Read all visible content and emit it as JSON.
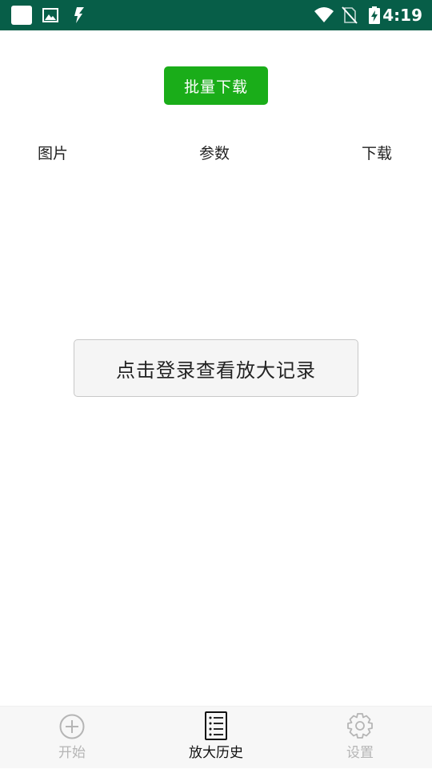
{
  "status_bar": {
    "time": "4:19",
    "icons": [
      "notification-square-icon",
      "image-icon",
      "bolt-app-icon",
      "wifi-icon",
      "no-sim-icon",
      "battery-charging-icon"
    ],
    "background_color": "#075e48"
  },
  "toolbar": {
    "batch_download_label": "批量下载",
    "accent_color": "#1aad19"
  },
  "table": {
    "headers": [
      "图片",
      "参数",
      "下载"
    ]
  },
  "main": {
    "login_prompt": "点击登录查看放大记录"
  },
  "bottom_nav": {
    "items": [
      {
        "label": "开始",
        "icon": "add-circle-icon",
        "active": false
      },
      {
        "label": "放大历史",
        "icon": "list-document-icon",
        "active": true
      },
      {
        "label": "设置",
        "icon": "gear-icon",
        "active": false
      }
    ]
  }
}
